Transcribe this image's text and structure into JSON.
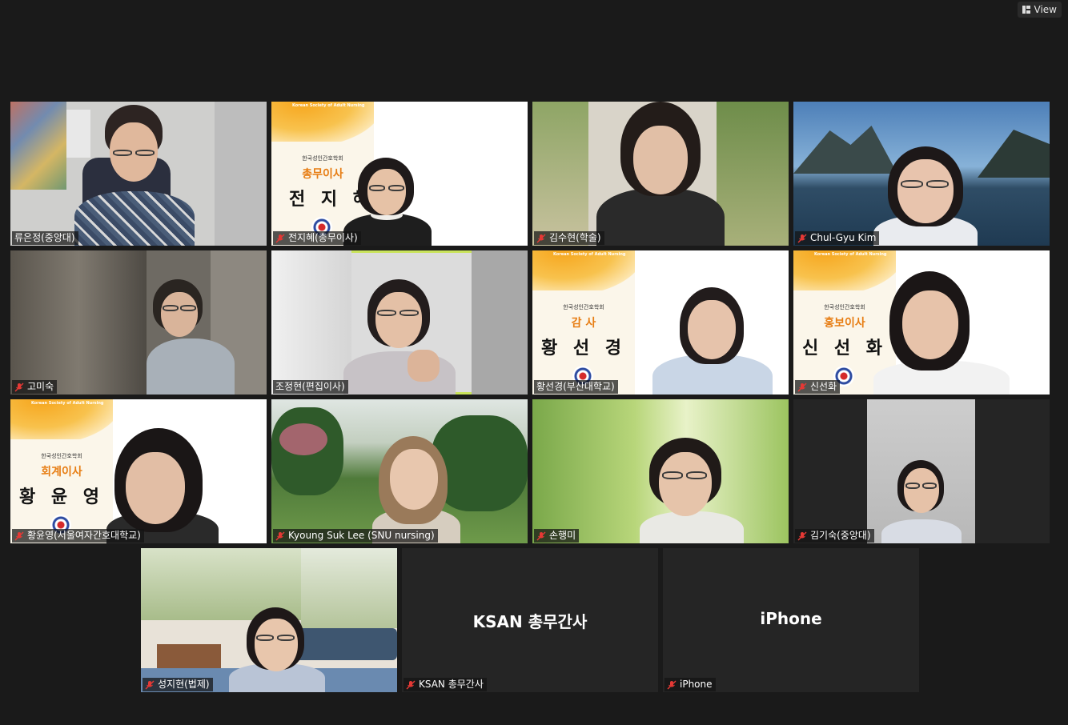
{
  "toolbar": {
    "view_label": "View"
  },
  "participants": [
    {
      "name": "류은정(중앙대)",
      "muted": false
    },
    {
      "name": "전지혜(총무이사)",
      "muted": true
    },
    {
      "name": "김수현(학술)",
      "muted": true
    },
    {
      "name": "Chul-Gyu Kim",
      "muted": true
    },
    {
      "name": "고미숙",
      "muted": true
    },
    {
      "name": "조정현(편집이사)",
      "muted": false,
      "active_speaker": true
    },
    {
      "name": "황선경(부산대학교)",
      "muted": false
    },
    {
      "name": "신선화",
      "muted": true
    },
    {
      "name": "황윤영(서울여자간호대학교)",
      "muted": true
    },
    {
      "name": "Kyoung Suk Lee (SNU nursing)",
      "muted": true
    },
    {
      "name": "손행미",
      "muted": true
    },
    {
      "name": "김기숙(중앙대)",
      "muted": true
    },
    {
      "name": "성지현(법제)",
      "muted": true
    },
    {
      "name": "KSAN 총무간사",
      "muted": true,
      "video_off": true,
      "display_name": "KSAN 총무간사"
    },
    {
      "name": "iPhone",
      "muted": true,
      "video_off": true,
      "display_name": "iPhone"
    }
  ],
  "slides": {
    "header": "Korean Society of Adult Nursing",
    "org": "한국성인간호학회",
    "general": {
      "role": "총무이사",
      "name": "전 지 혜"
    },
    "thanks": {
      "role": "감  사",
      "name": "황 선 경"
    },
    "pr": {
      "role": "홍보이사",
      "name": "신 선 화"
    },
    "accounting": {
      "role": "회계이사",
      "name": "황 윤 영"
    }
  },
  "colors": {
    "background": "#1a1a1a",
    "active_speaker_border": "#c9e35b",
    "mic_off": "#e53935",
    "slide_accent": "#e77d13"
  }
}
